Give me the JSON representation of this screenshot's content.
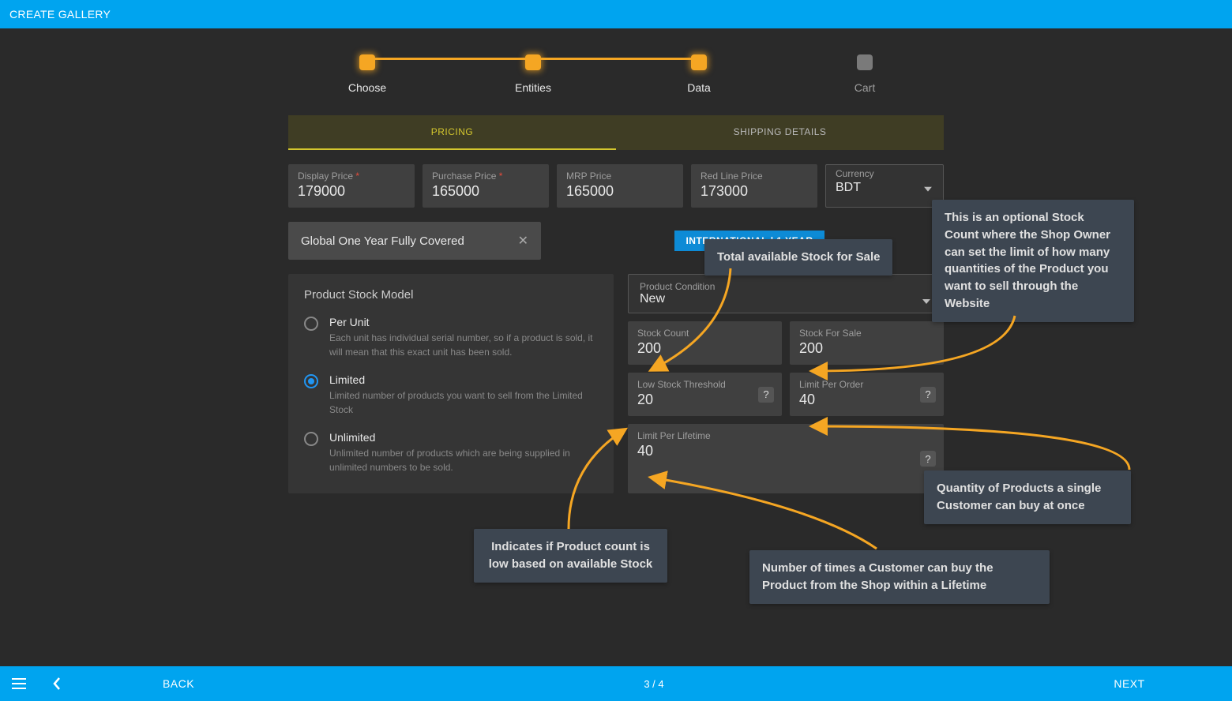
{
  "header": {
    "title": "CREATE GALLERY"
  },
  "stepper": {
    "steps": [
      {
        "label": "Choose",
        "active": true
      },
      {
        "label": "Entities",
        "active": true
      },
      {
        "label": "Data",
        "active": true
      },
      {
        "label": "Cart",
        "active": false
      }
    ]
  },
  "tabs": {
    "pricing": "PRICING",
    "shipping": "SHIPPING DETAILS"
  },
  "pricing": {
    "display_price": {
      "label": "Display Price",
      "value": "179000",
      "required": true
    },
    "purchase_price": {
      "label": "Purchase Price",
      "value": "165000",
      "required": true
    },
    "mrp_price": {
      "label": "MRP Price",
      "value": "165000",
      "required": false
    },
    "red_line_price": {
      "label": "Red Line Price",
      "value": "173000",
      "required": false
    },
    "currency": {
      "label": "Currency",
      "value": "BDT"
    }
  },
  "warranty": {
    "text": "Global One Year Fully Covered",
    "badge": "INTERNATIONAL | 1 YEAR"
  },
  "stock_model": {
    "title": "Product Stock Model",
    "per_unit": {
      "label": "Per Unit",
      "desc": "Each unit has individual serial number, so if a product is sold, it will mean that this exact unit has been sold."
    },
    "limited": {
      "label": "Limited",
      "desc": "Limited number of products you want to sell from the Limited Stock"
    },
    "unlimited": {
      "label": "Unlimited",
      "desc": "Unlimited number of products which are being supplied in unlimited numbers to be sold."
    }
  },
  "condition": {
    "label": "Product Condition",
    "value": "New"
  },
  "stock": {
    "stock_count": {
      "label": "Stock Count",
      "value": "200"
    },
    "stock_for_sale": {
      "label": "Stock For Sale",
      "value": "200"
    },
    "low_threshold": {
      "label": "Low Stock Threshold",
      "value": "20"
    },
    "limit_per_order": {
      "label": "Limit Per Order",
      "value": "40"
    },
    "limit_per_lifetime": {
      "label": "Limit Per Lifetime",
      "value": "40"
    }
  },
  "footer": {
    "back": "BACK",
    "page": "3 / 4",
    "next": "NEXT"
  },
  "callouts": {
    "total_stock": "Total available Stock for Sale",
    "stock_for_sale": "This is an optional Stock Count where the Shop Owner can set the limit of how many quantities of the Product you want to sell through the Website",
    "low_threshold": "Indicates if Product count is low based on available Stock",
    "limit_per_order": "Quantity of Products a single Customer can buy at once",
    "limit_per_lifetime": "Number of times a Customer can buy the Product from the Shop within a Lifetime"
  }
}
